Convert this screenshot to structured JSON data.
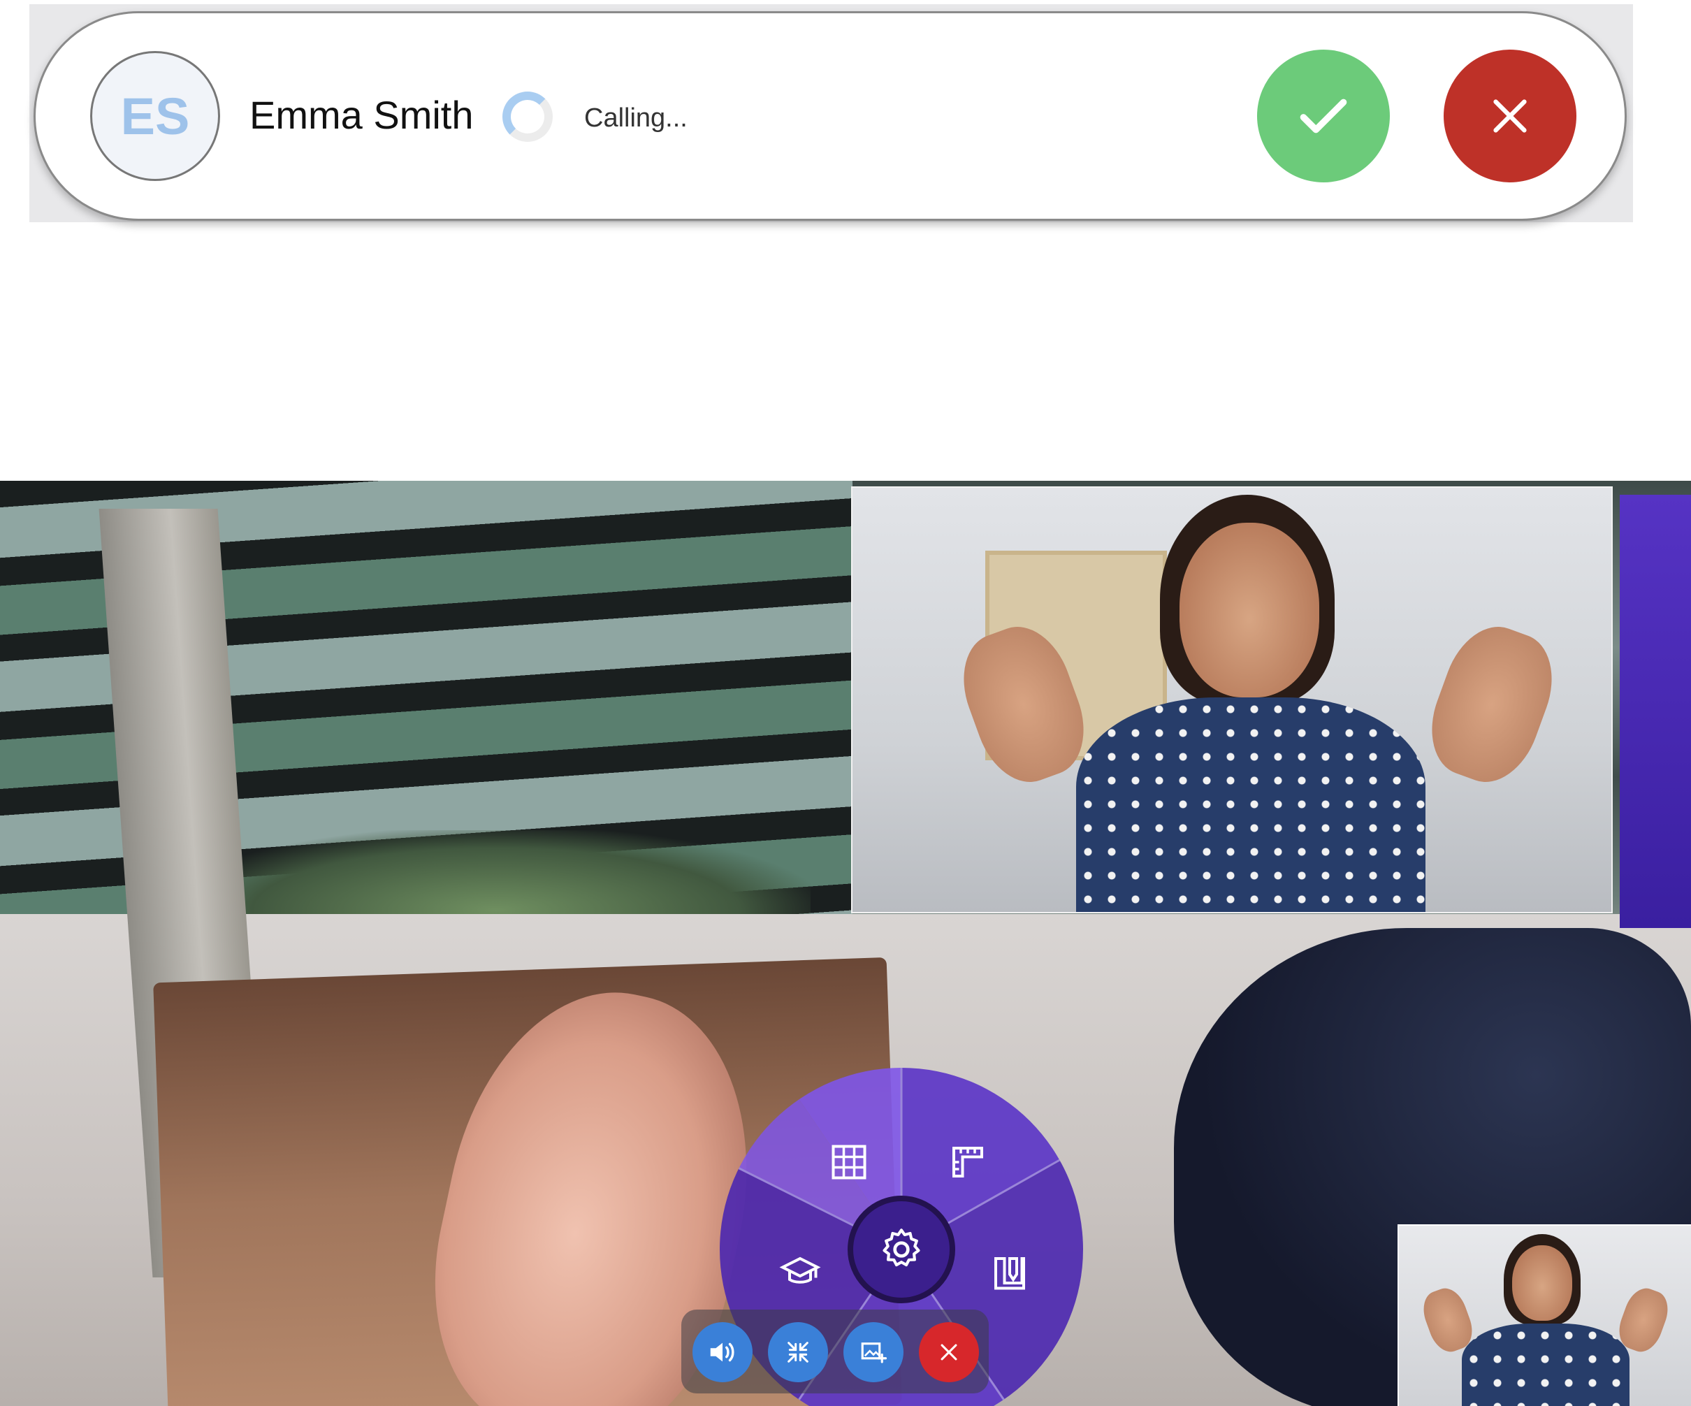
{
  "incoming_call": {
    "avatar_initials": "ES",
    "caller_name": "Emma Smith",
    "status": "Calling...",
    "accept_icon": "check-icon",
    "decline_icon": "close-icon",
    "colors": {
      "accept": "#6ccb7a",
      "decline": "#be3128",
      "avatar_text": "#9ec2ea"
    }
  },
  "video_call": {
    "radial_menu": {
      "items": [
        "grid-icon",
        "ruler-icon",
        "graduation-cap-icon",
        "document-edit-icon",
        "gear-icon"
      ],
      "color": "#5a33c6"
    },
    "controls": [
      {
        "name": "speaker",
        "icon": "speaker-icon",
        "color": "#3a80d8"
      },
      {
        "name": "minimize",
        "icon": "minimize-arrows-icon",
        "color": "#3a80d8"
      },
      {
        "name": "add-image",
        "icon": "add-image-icon",
        "color": "#3a80d8"
      },
      {
        "name": "end-call",
        "icon": "close-icon",
        "color": "#d7272b"
      }
    ]
  }
}
